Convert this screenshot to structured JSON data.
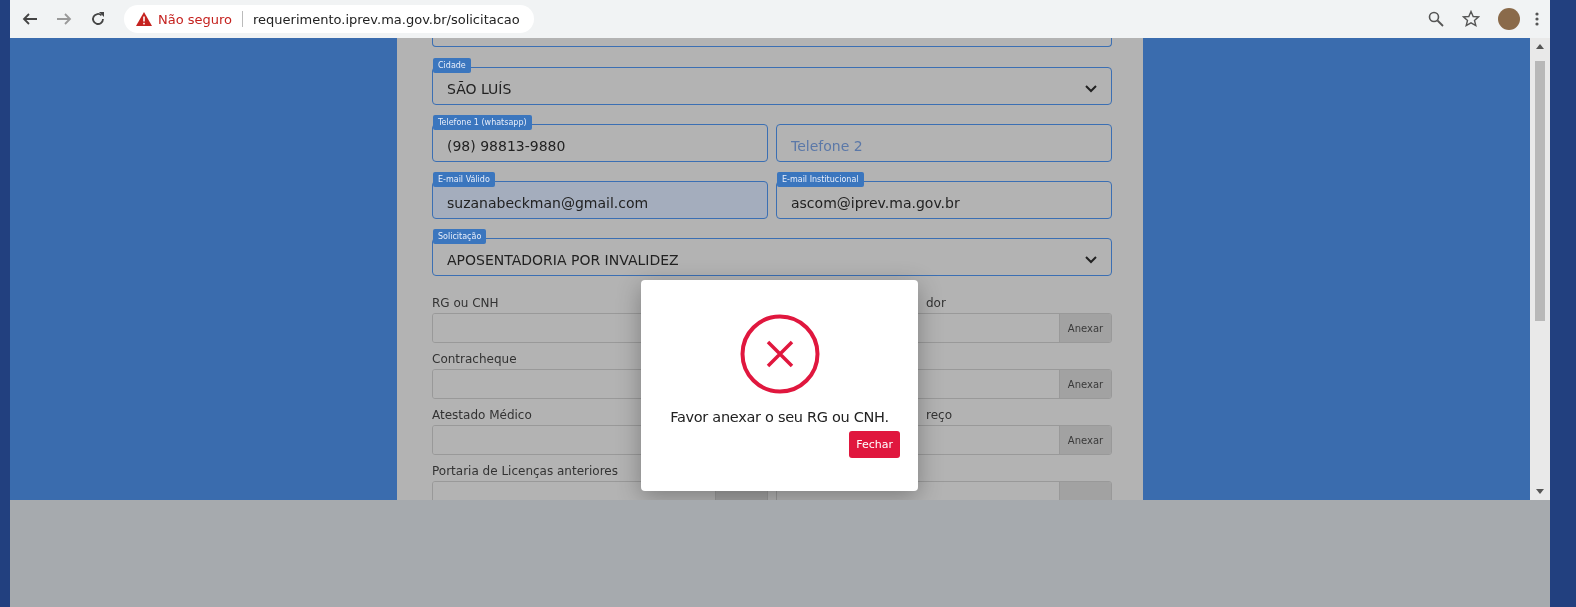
{
  "browser": {
    "security_label": "Não seguro",
    "url": "requerimento.iprev.ma.gov.br/solicitacao"
  },
  "form": {
    "field_rows": [
      [
        {
          "kind": "select",
          "label": "Cidade",
          "value": "SÃO LUÍS",
          "autofilled": false
        }
      ],
      [
        {
          "kind": "input",
          "label": "Telefone 1 (whatsapp)",
          "value": "(98) 98813-9880",
          "autofilled": false
        },
        {
          "kind": "input",
          "placeholder": "Telefone 2",
          "autofilled": false
        }
      ],
      [
        {
          "kind": "input",
          "label": "E-mail Válido",
          "value": "suzanabeckman@gmail.com",
          "autofilled": true
        },
        {
          "kind": "input",
          "label": "E-mail Institucional",
          "value": "ascom@iprev.ma.gov.br",
          "autofilled": false
        }
      ],
      [
        {
          "kind": "select",
          "label": "Solicitação",
          "value": "APOSENTADORIA POR INVALIDEZ",
          "autofilled": false
        }
      ]
    ],
    "uploads": [
      [
        {
          "label": "RG ou CNH"
        },
        {
          "label": "dor",
          "button": "Anexar"
        }
      ],
      [
        {
          "label": "Contracheque"
        },
        {
          "button": "Anexar"
        }
      ],
      [
        {
          "label": "Atestado Médico"
        },
        {
          "label": "reço",
          "button": "Anexar"
        }
      ],
      [
        {
          "label": "Portaria de Licenças anteriores"
        }
      ]
    ]
  },
  "modal": {
    "message": "Favor anexar o seu RG ou CNH.",
    "button": "Fechar"
  }
}
